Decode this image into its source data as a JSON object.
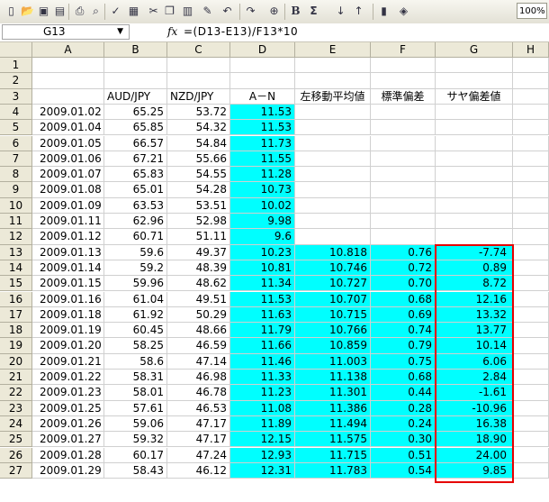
{
  "toolbar": {
    "icons": [
      "new-file-icon",
      "open-folder-icon",
      "save-icon",
      "permission-icon",
      "print-icon",
      "print-preview-icon",
      "spellcheck-icon",
      "research-icon",
      "cut-icon",
      "copy-icon",
      "paste-icon",
      "format-painter-icon",
      "undo-icon",
      "redo-icon",
      "hyperlink-icon",
      "bold-icon",
      "autosum-icon",
      "sort-asc-icon",
      "sort-desc-icon",
      "chart-wizard-icon",
      "drawing-icon"
    ],
    "bold_label": "B",
    "sum_label": "Σ",
    "zoom": "100%"
  },
  "formula_bar": {
    "name_box": "G13",
    "fx": "fx",
    "formula": "=(D13-E13)/F13*10"
  },
  "columns": [
    "A",
    "B",
    "C",
    "D",
    "E",
    "F",
    "G",
    "H"
  ],
  "header_row": {
    "row": "3",
    "b": "AUD/JPY",
    "c": "NZD/JPY",
    "d": "A－N",
    "e": "左移動平均値",
    "f": "標準偏差",
    "g": "サヤ偏差値"
  },
  "rows": [
    {
      "n": "1",
      "a": "",
      "b": "",
      "c": "",
      "d": "",
      "e": "",
      "f": "",
      "g": ""
    },
    {
      "n": "2",
      "a": "",
      "b": "",
      "c": "",
      "d": "",
      "e": "",
      "f": "",
      "g": ""
    },
    {
      "n": "4",
      "a": "2009.01.02",
      "b": "65.25",
      "c": "53.72",
      "d": "11.53",
      "e": "",
      "f": "",
      "g": ""
    },
    {
      "n": "5",
      "a": "2009.01.04",
      "b": "65.85",
      "c": "54.32",
      "d": "11.53",
      "e": "",
      "f": "",
      "g": ""
    },
    {
      "n": "6",
      "a": "2009.01.05",
      "b": "66.57",
      "c": "54.84",
      "d": "11.73",
      "e": "",
      "f": "",
      "g": ""
    },
    {
      "n": "7",
      "a": "2009.01.06",
      "b": "67.21",
      "c": "55.66",
      "d": "11.55",
      "e": "",
      "f": "",
      "g": ""
    },
    {
      "n": "8",
      "a": "2009.01.07",
      "b": "65.83",
      "c": "54.55",
      "d": "11.28",
      "e": "",
      "f": "",
      "g": ""
    },
    {
      "n": "9",
      "a": "2009.01.08",
      "b": "65.01",
      "c": "54.28",
      "d": "10.73",
      "e": "",
      "f": "",
      "g": ""
    },
    {
      "n": "10",
      "a": "2009.01.09",
      "b": "63.53",
      "c": "53.51",
      "d": "10.02",
      "e": "",
      "f": "",
      "g": ""
    },
    {
      "n": "11",
      "a": "2009.01.11",
      "b": "62.96",
      "c": "52.98",
      "d": "9.98",
      "e": "",
      "f": "",
      "g": ""
    },
    {
      "n": "12",
      "a": "2009.01.12",
      "b": "60.71",
      "c": "51.11",
      "d": "9.6",
      "e": "",
      "f": "",
      "g": ""
    },
    {
      "n": "13",
      "a": "2009.01.13",
      "b": "59.6",
      "c": "49.37",
      "d": "10.23",
      "e": "10.818",
      "f": "0.76",
      "g": "-7.74"
    },
    {
      "n": "14",
      "a": "2009.01.14",
      "b": "59.2",
      "c": "48.39",
      "d": "10.81",
      "e": "10.746",
      "f": "0.72",
      "g": "0.89"
    },
    {
      "n": "15",
      "a": "2009.01.15",
      "b": "59.96",
      "c": "48.62",
      "d": "11.34",
      "e": "10.727",
      "f": "0.70",
      "g": "8.72"
    },
    {
      "n": "16",
      "a": "2009.01.16",
      "b": "61.04",
      "c": "49.51",
      "d": "11.53",
      "e": "10.707",
      "f": "0.68",
      "g": "12.16"
    },
    {
      "n": "17",
      "a": "2009.01.18",
      "b": "61.92",
      "c": "50.29",
      "d": "11.63",
      "e": "10.715",
      "f": "0.69",
      "g": "13.32"
    },
    {
      "n": "18",
      "a": "2009.01.19",
      "b": "60.45",
      "c": "48.66",
      "d": "11.79",
      "e": "10.766",
      "f": "0.74",
      "g": "13.77"
    },
    {
      "n": "19",
      "a": "2009.01.20",
      "b": "58.25",
      "c": "46.59",
      "d": "11.66",
      "e": "10.859",
      "f": "0.79",
      "g": "10.14"
    },
    {
      "n": "20",
      "a": "2009.01.21",
      "b": "58.6",
      "c": "47.14",
      "d": "11.46",
      "e": "11.003",
      "f": "0.75",
      "g": "6.06"
    },
    {
      "n": "21",
      "a": "2009.01.22",
      "b": "58.31",
      "c": "46.98",
      "d": "11.33",
      "e": "11.138",
      "f": "0.68",
      "g": "2.84"
    },
    {
      "n": "22",
      "a": "2009.01.23",
      "b": "58.01",
      "c": "46.78",
      "d": "11.23",
      "e": "11.301",
      "f": "0.44",
      "g": "-1.61"
    },
    {
      "n": "23",
      "a": "2009.01.25",
      "b": "57.61",
      "c": "46.53",
      "d": "11.08",
      "e": "11.386",
      "f": "0.28",
      "g": "-10.96"
    },
    {
      "n": "24",
      "a": "2009.01.26",
      "b": "59.06",
      "c": "47.17",
      "d": "11.89",
      "e": "11.494",
      "f": "0.24",
      "g": "16.38"
    },
    {
      "n": "25",
      "a": "2009.01.27",
      "b": "59.32",
      "c": "47.17",
      "d": "12.15",
      "e": "11.575",
      "f": "0.30",
      "g": "18.90"
    },
    {
      "n": "26",
      "a": "2009.01.28",
      "b": "60.17",
      "c": "47.24",
      "d": "12.93",
      "e": "11.715",
      "f": "0.51",
      "g": "24.00"
    },
    {
      "n": "27",
      "a": "2009.01.29",
      "b": "58.43",
      "c": "46.12",
      "d": "12.31",
      "e": "11.783",
      "f": "0.54",
      "g": "9.85"
    }
  ]
}
